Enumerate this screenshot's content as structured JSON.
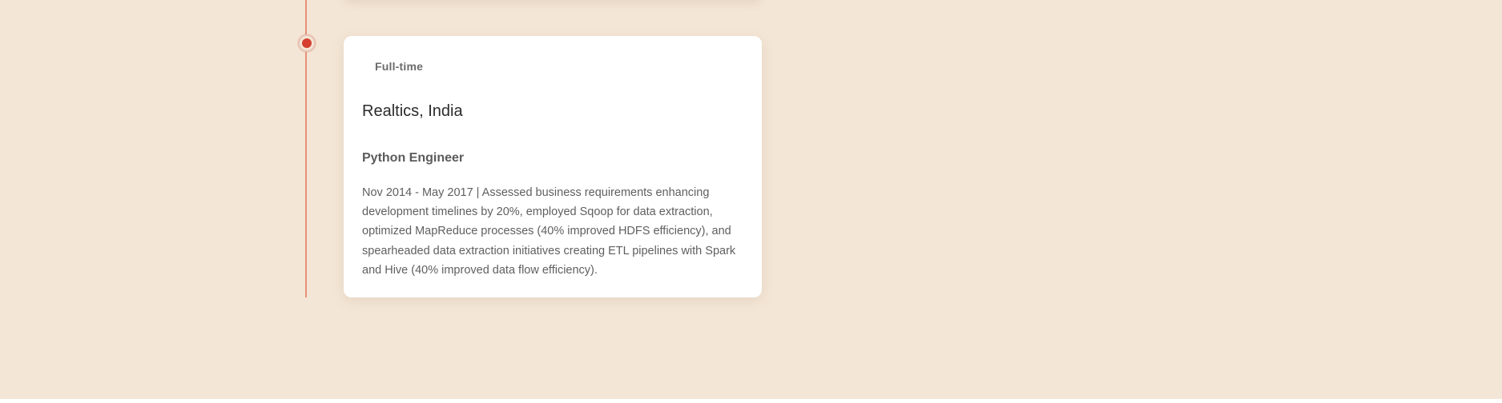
{
  "timeline": {
    "accent_color": "#d63f30",
    "line_color": "#e5907a",
    "background_color": "#f4e6d6"
  },
  "experience": {
    "type_tag": "Full-time",
    "company": "Realtics, India",
    "role": "Python Engineer",
    "description": "Nov 2014 - May 2017 | Assessed business requirements enhancing development timelines by 20%, employed Sqoop for data extraction, optimized MapReduce processes (40% improved HDFS efficiency), and spearheaded data extraction initiatives creating ETL pipelines with Spark and Hive (40% improved data flow efficiency)."
  }
}
